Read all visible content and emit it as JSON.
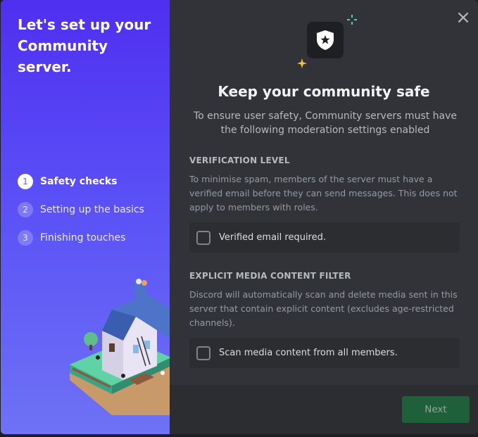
{
  "sidebar": {
    "heading": "Let's set up your Community server.",
    "steps": [
      {
        "number": "1",
        "label": "Safety checks",
        "active": true
      },
      {
        "number": "2",
        "label": "Setting up the basics",
        "active": false
      },
      {
        "number": "3",
        "label": "Finishing touches",
        "active": false
      }
    ]
  },
  "header": {
    "close_icon": "close-icon",
    "icon": "shield-star-icon",
    "title": "Keep your community safe",
    "subtitle": "To ensure user safety, Community servers must have the following moderation settings enabled"
  },
  "verification": {
    "title": "VERIFICATION LEVEL",
    "description": "To minimise spam, members of the server must have a verified email before they can send messages. This does not apply to members with roles.",
    "checkbox_label": "Verified email required.",
    "checked": false
  },
  "media_filter": {
    "title": "EXPLICIT MEDIA CONTENT FILTER",
    "description": "Discord will automatically scan and delete media sent in this server that contain explicit content (excludes age-restricted channels).",
    "checkbox_label": "Scan media content from all members.",
    "checked": false
  },
  "footer": {
    "next_label": "Next"
  },
  "colors": {
    "brand": "#5865f2",
    "panel": "#313338",
    "next_button": "#1f5f3a"
  }
}
